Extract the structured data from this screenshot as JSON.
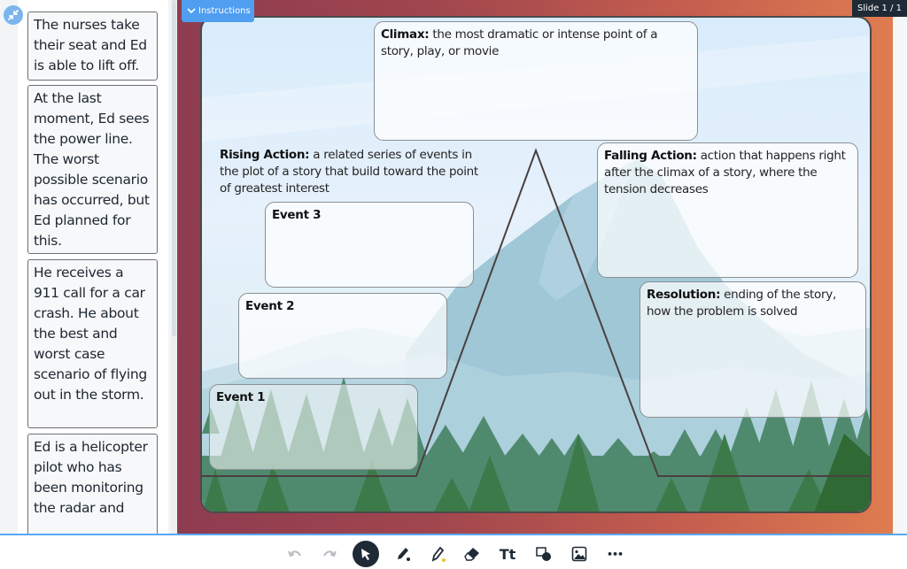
{
  "sidebar": {
    "cards": [
      {
        "text": "The nurses take their seat and Ed is able to lift off."
      },
      {
        "text": "At the last moment, Ed sees the power line. The worst possible scenario has occurred, but Ed planned for this."
      },
      {
        "text": "He receives a 911 call for a car crash. He about the best and worst case scenario of flying out in the storm."
      },
      {
        "text": "Ed is a helicopter pilot who has been monitoring the radar and"
      }
    ]
  },
  "header": {
    "instructions_label": "Instructions",
    "slide_counter": "Slide 1 / 1"
  },
  "slide": {
    "climax": {
      "term": "Climax:",
      "definition": " the most dramatic or intense point of a story, play, or movie"
    },
    "rising_action": {
      "term": "Rising Action:",
      "definition": " a related series of events in the plot of a story that build toward the point of greatest interest"
    },
    "falling_action": {
      "term": "Falling Action:",
      "definition": " action that happens right after the climax of a story, where the tension decreases"
    },
    "resolution": {
      "term": "Resolution:",
      "definition": " ending of the story, how the problem is solved"
    },
    "events": [
      {
        "label": "Event 3"
      },
      {
        "label": "Event 2"
      },
      {
        "label": "Event 1"
      }
    ]
  },
  "toolbar": {
    "tools": [
      {
        "name": "undo",
        "icon": "undo-icon"
      },
      {
        "name": "redo",
        "icon": "redo-icon"
      },
      {
        "name": "select",
        "icon": "cursor-icon",
        "active": true
      },
      {
        "name": "pen",
        "icon": "pen-icon",
        "color": "#1f2a36"
      },
      {
        "name": "highlighter",
        "icon": "highlighter-icon",
        "color": "#f2c12e"
      },
      {
        "name": "eraser",
        "icon": "eraser-icon"
      },
      {
        "name": "text",
        "icon": "text-icon",
        "label": "Tt"
      },
      {
        "name": "shapes",
        "icon": "shapes-icon"
      },
      {
        "name": "image",
        "icon": "image-icon"
      },
      {
        "name": "more",
        "icon": "more-icon",
        "label": "•••"
      }
    ]
  },
  "colors": {
    "accent": "#4f9ef0",
    "frame_left": "#8e3c50",
    "frame_right": "#e07e50",
    "toolbar_dark": "#1f2a36"
  }
}
